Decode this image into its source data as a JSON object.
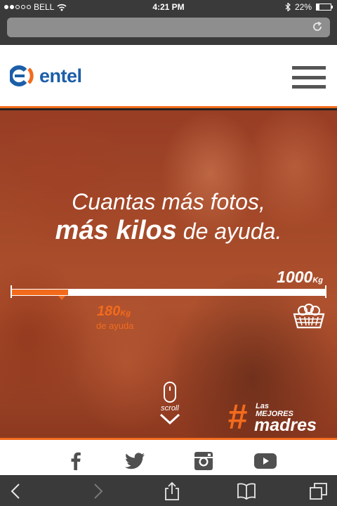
{
  "status_bar": {
    "carrier": "BELL",
    "time": "4:21 PM",
    "battery": "22%",
    "battery_level": 0.22,
    "signal_strength": 2
  },
  "brand": {
    "name": "entel",
    "accent_color": "#f26b1d",
    "logo_color": "#1c5ea8"
  },
  "hero": {
    "headline_line1": "Cuantas más fotos,",
    "headline_emphasis": "más kilos",
    "headline_line2_rest": " de ayuda.",
    "goal_value": "1000",
    "goal_unit": "Kg",
    "current_value": "180",
    "current_unit": "Kg",
    "current_caption": "de ayuda",
    "progress_fraction": 0.18,
    "scroll_label": "scroll",
    "hashtag_symbol": "#",
    "hashtag_line1": "Las",
    "hashtag_line2": "MEJORES",
    "hashtag_line3": "madres"
  },
  "social": [
    "facebook-icon",
    "twitter-icon",
    "instagram-icon",
    "youtube-icon"
  ],
  "toolbar": [
    "back-icon",
    "forward-icon",
    "share-icon",
    "bookmarks-icon",
    "tabs-icon"
  ]
}
